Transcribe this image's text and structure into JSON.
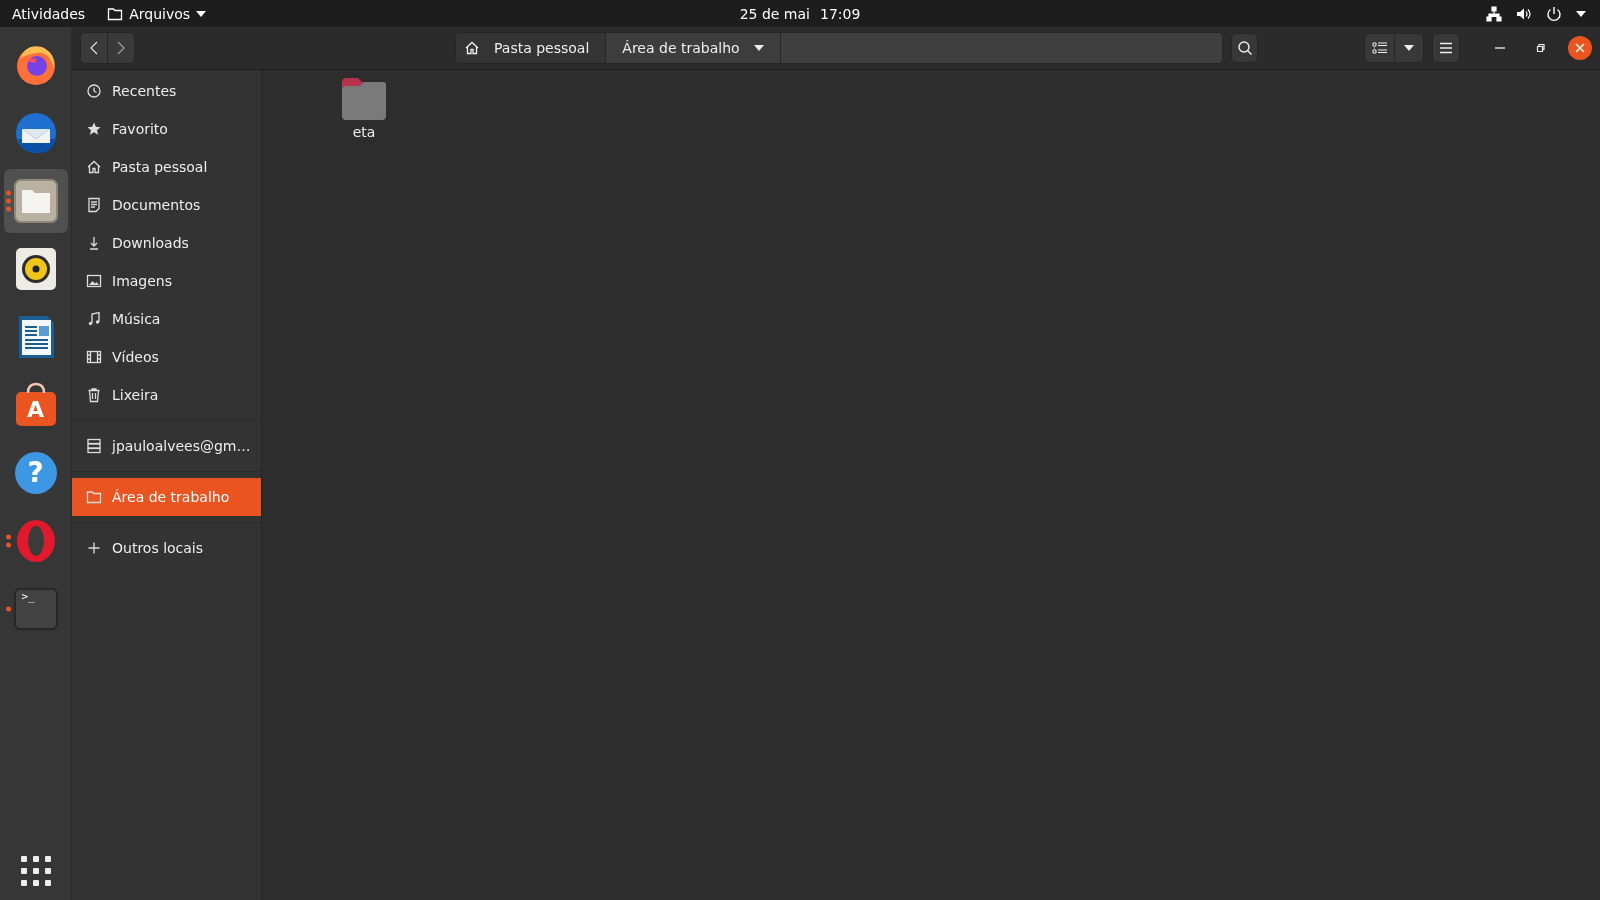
{
  "top_bar": {
    "activities": "Atividades",
    "app_menu": {
      "label": "Arquivos"
    },
    "date": "25 de mai",
    "time": "17:09"
  },
  "dock": {
    "apps": [
      {
        "kind": "firefox",
        "selected": false
      },
      {
        "kind": "thunderbird",
        "selected": false
      },
      {
        "kind": "files",
        "selected": true,
        "running_dots": [
          {
            "color": "#e95420"
          },
          {
            "color": "#e95420"
          },
          {
            "color": "#e95420"
          }
        ]
      },
      {
        "kind": "rhythmbox",
        "selected": false
      },
      {
        "kind": "writer",
        "selected": false
      },
      {
        "kind": "software",
        "selected": false,
        "glyph": "A"
      },
      {
        "kind": "help",
        "selected": false,
        "glyph": "?"
      },
      {
        "kind": "opera",
        "selected": false,
        "running_dots": [
          {
            "color": "#e95420"
          },
          {
            "color": "#e95420"
          }
        ]
      },
      {
        "kind": "terminal",
        "selected": false,
        "running_dots": [
          {
            "color": "#e95420"
          }
        ],
        "glyph": ">_"
      }
    ]
  },
  "path_bar": [
    {
      "label": "Pasta pessoal",
      "kind": "home",
      "selected": false
    },
    {
      "label": "Área de trabalho",
      "kind": "current",
      "selected": true
    }
  ],
  "sidebar": {
    "sections": [
      {
        "items": [
          {
            "label": "Recentes",
            "kind": "clock",
            "selected": false
          },
          {
            "label": "Favorito",
            "kind": "star",
            "selected": false
          },
          {
            "label": "Pasta pessoal",
            "kind": "home",
            "selected": false
          },
          {
            "label": "Documentos",
            "kind": "document",
            "selected": false
          },
          {
            "label": "Downloads",
            "kind": "download",
            "selected": false
          },
          {
            "label": "Imagens",
            "kind": "image",
            "selected": false
          },
          {
            "label": "Música",
            "kind": "music",
            "selected": false
          },
          {
            "label": "Vídeos",
            "kind": "film",
            "selected": false
          },
          {
            "label": "Lixeira",
            "kind": "trash",
            "selected": false
          }
        ]
      },
      {
        "items": [
          {
            "label": "jpauloalvees@gm…",
            "kind": "server",
            "selected": false
          }
        ]
      },
      {
        "items": [
          {
            "label": "Área de trabalho",
            "kind": "folder",
            "selected": true
          }
        ]
      },
      {
        "items": [
          {
            "label": "Outros locais",
            "kind": "plus",
            "selected": false
          }
        ]
      }
    ]
  },
  "files": [
    {
      "name": "eta"
    }
  ]
}
